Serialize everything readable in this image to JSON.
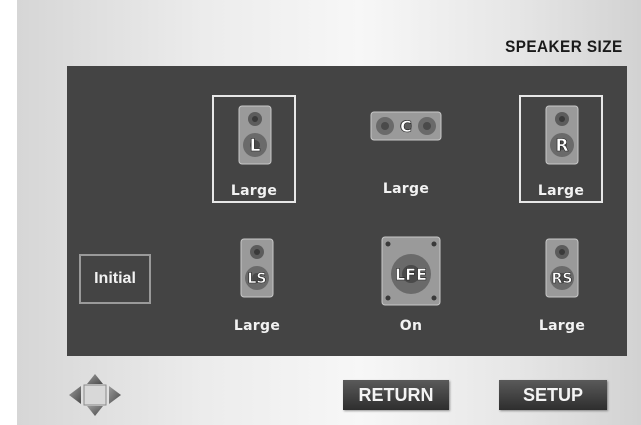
{
  "screen": {
    "title": "SPEAKER SIZE"
  },
  "speakers": {
    "front_left": {
      "icon_text": "L",
      "size_label": "Large"
    },
    "center": {
      "icon_text": "C",
      "size_label": "Large"
    },
    "front_right": {
      "icon_text": "R",
      "size_label": "Large"
    },
    "surround_left": {
      "icon_text": "LS",
      "size_label": "Large"
    },
    "subwoofer": {
      "icon_text": "LFE",
      "size_label": "On"
    },
    "surround_right": {
      "icon_text": "RS",
      "size_label": "Large"
    }
  },
  "initial_button": {
    "label": "Initial"
  },
  "footer": {
    "return_label": "RETURN",
    "setup_label": "SETUP"
  },
  "icons": {
    "navigation": "dpad-icon",
    "speaker": "speaker-icon",
    "center_speaker": "center-speaker-icon",
    "subwoofer": "subwoofer-icon"
  },
  "colors": {
    "panel": "#444444",
    "text": "#f2f2f2",
    "selection_border": "#e8e8e8"
  }
}
